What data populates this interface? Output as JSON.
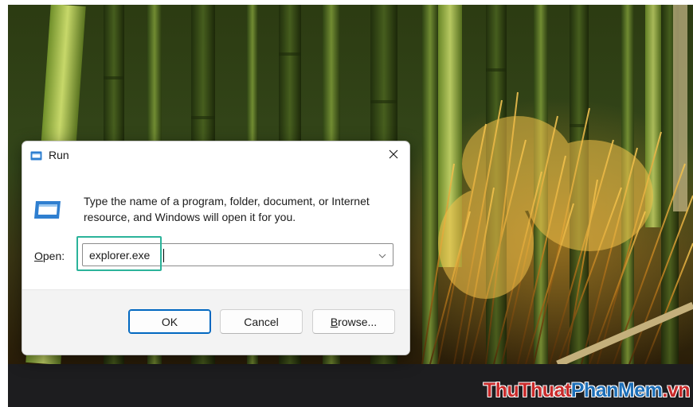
{
  "dialog": {
    "title": "Run",
    "description": "Type the name of a program, folder, document, or Internet resource, and Windows will open it for you.",
    "open_label_first": "O",
    "open_label_rest": "pen:",
    "open_value": "explorer.exe",
    "buttons": {
      "ok": "OK",
      "cancel": "Cancel",
      "browse_first": "B",
      "browse_rest": "rowse..."
    }
  },
  "icons": {
    "title": "run-icon",
    "content": "run-icon",
    "close": "close-icon",
    "dropdown": "chevron-down-icon"
  },
  "watermark": {
    "part1": "ThuThuat",
    "part2": "PhanMem",
    "part3": ".vn"
  },
  "colors": {
    "highlight": "#2bb39a",
    "primary_button_border": "#0067c0",
    "watermark_red": "#c92a2a",
    "watermark_blue": "#1d6fb8"
  }
}
